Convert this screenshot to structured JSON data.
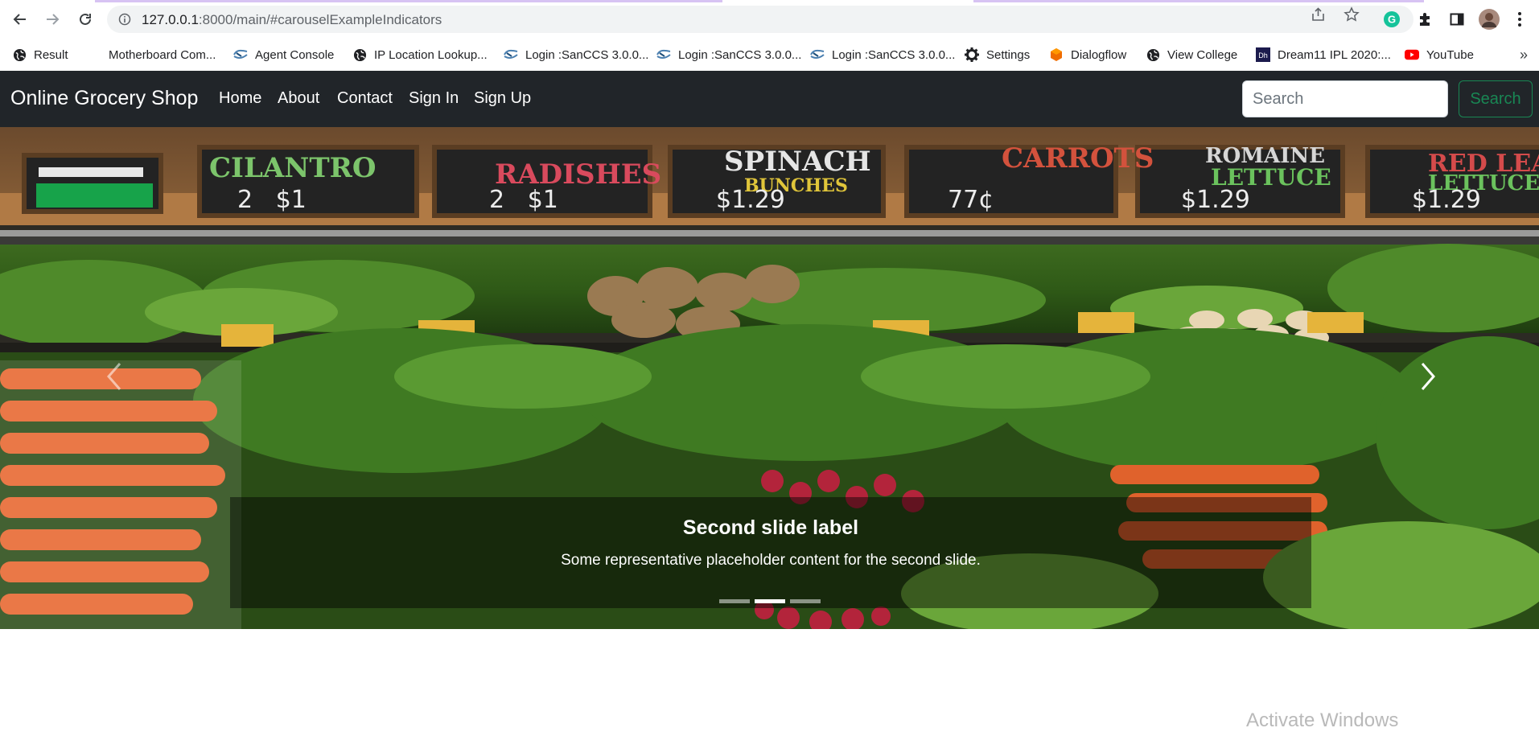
{
  "browser": {
    "url_host": "127.0.0.1",
    "url_rest": ":8000/main/#carouselExampleIndicators"
  },
  "bookmarks": [
    {
      "label": "Result",
      "icon": "globe-icon"
    },
    {
      "label": "Motherboard Com...",
      "icon": "blank-icon"
    },
    {
      "label": "Agent Console",
      "icon": "sanccs-icon"
    },
    {
      "label": "IP Location Lookup...",
      "icon": "globe-icon"
    },
    {
      "label": "Login :SanCCS 3.0.0...",
      "icon": "sanccs-icon"
    },
    {
      "label": "Login :SanCCS 3.0.0...",
      "icon": "sanccs-icon"
    },
    {
      "label": "Login :SanCCS 3.0.0...",
      "icon": "sanccs-icon"
    },
    {
      "label": "Settings",
      "icon": "gear-icon"
    },
    {
      "label": "Dialogflow",
      "icon": "dialogflow-icon"
    },
    {
      "label": "View College",
      "icon": "globe-icon"
    },
    {
      "label": "Dream11 IPL 2020:...",
      "icon": "dream11-icon"
    },
    {
      "label": "YouTube",
      "icon": "youtube-icon"
    }
  ],
  "site": {
    "brand": "Online Grocery Shop",
    "nav": [
      "Home",
      "About",
      "Contact",
      "Sign In",
      "Sign Up"
    ],
    "search_placeholder": "Search",
    "search_button": "Search"
  },
  "carousel": {
    "caption_title": "Second slide label",
    "caption_text": "Some representative placeholder content for the second slide.",
    "active_index": 1,
    "slide_count": 3
  },
  "overlay": {
    "watermark": "Activate Windows"
  },
  "colors": {
    "navbar": "#212529",
    "search_button": "#198754"
  }
}
